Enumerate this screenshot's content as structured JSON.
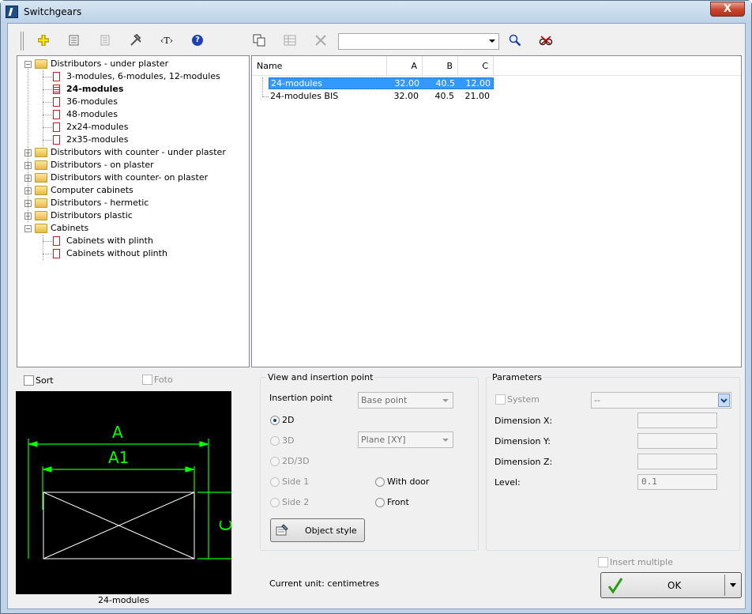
{
  "window": {
    "title": "Switchgears",
    "close_glyph": "X"
  },
  "toolbar": {
    "search_value": "",
    "icons": [
      "add-icon",
      "properties-icon",
      "list-icon",
      "tools-icon",
      "text-icon",
      "help-icon",
      "copy-icon",
      "table-icon",
      "delete-icon",
      "search-icon",
      "find-icon"
    ],
    "text_icon_label": "‹T›",
    "help_glyph": "?"
  },
  "tree": {
    "items": [
      {
        "label": "Distributors - under plaster",
        "type": "folder",
        "expanded": true
      },
      {
        "label": "3-modules, 6-modules, 12-modules",
        "type": "doc"
      },
      {
        "label": "24-modules",
        "type": "doc",
        "selected": true
      },
      {
        "label": "36-modules",
        "type": "doc"
      },
      {
        "label": "48-modules",
        "type": "doc"
      },
      {
        "label": "2x24-modules",
        "type": "doc"
      },
      {
        "label": "2x35-modules",
        "type": "doc"
      },
      {
        "label": "Distributors with counter - under plaster",
        "type": "folder"
      },
      {
        "label": "Distributors - on plaster",
        "type": "folder"
      },
      {
        "label": "Distributors with counter- on plaster",
        "type": "folder"
      },
      {
        "label": "Computer cabinets",
        "type": "folder"
      },
      {
        "label": "Distributors - hermetic",
        "type": "folder"
      },
      {
        "label": "Distributors plastic",
        "type": "folder"
      },
      {
        "label": "Cabinets",
        "type": "folder",
        "expanded": true
      },
      {
        "label": "Cabinets with plinth",
        "type": "doc"
      },
      {
        "label": "Cabinets without plinth",
        "type": "doc"
      }
    ]
  },
  "list": {
    "columns": [
      "Name",
      "A",
      "B",
      "C"
    ],
    "rows": [
      {
        "name": "24-modules",
        "a": "32.00",
        "b": "40.5",
        "c": "12.00",
        "selected": true
      },
      {
        "name": "24-modules BIS",
        "a": "32.00",
        "b": "40.5",
        "c": "21.00"
      }
    ]
  },
  "left": {
    "sort_label": "Sort",
    "foto_label": "Foto",
    "preview_caption": "24-modules",
    "dim_a": "A",
    "dim_a1": "A1",
    "dim_c": "C"
  },
  "view": {
    "group_title": "View and insertion point",
    "insertion_label": "Insertion point",
    "insertion_value": "Base point",
    "r2d": "2D",
    "r3d": "3D",
    "r2d3d": "2D/3D",
    "side1": "Side 1",
    "side2": "Side 2",
    "plane_value": "Plane  [XY]",
    "with_door": "With door",
    "front": "Front",
    "object_style": "Object style"
  },
  "params": {
    "group_title": "Parameters",
    "system_label": "System",
    "system_value": "--",
    "dimx_label": "Dimension X:",
    "dimy_label": "Dimension Y:",
    "dimz_label": "Dimension Z:",
    "level_label": "Level:",
    "level_value": "0.1"
  },
  "footer": {
    "insert_multiple": "Insert multiple",
    "current_unit": "Current unit: centimetres",
    "ok": "OK"
  },
  "colors": {
    "selection": "#3399ff",
    "accent_green": "#2e9a1a"
  }
}
